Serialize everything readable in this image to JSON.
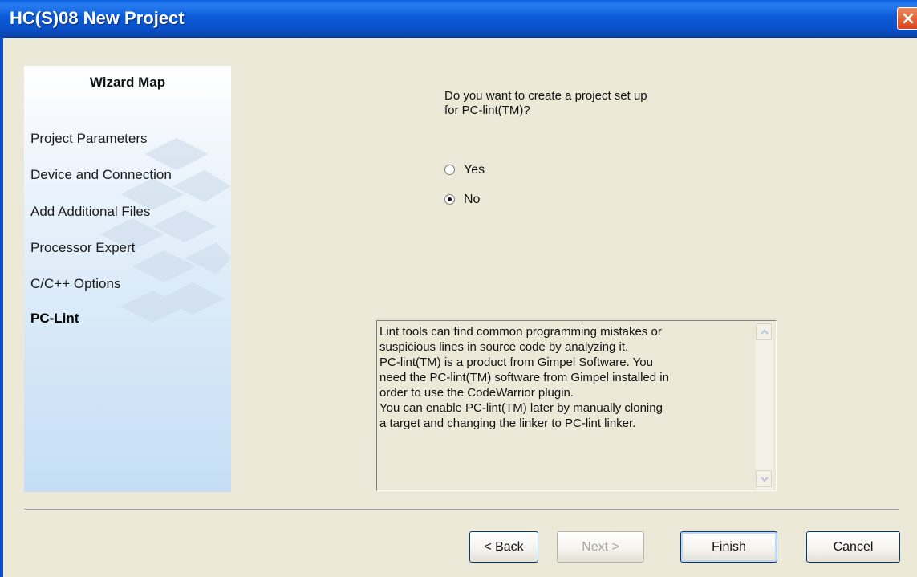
{
  "window": {
    "title": "HC(S)08 New Project"
  },
  "wizard_map": {
    "title": "Wizard Map",
    "items": [
      {
        "label": "Project Parameters"
      },
      {
        "label": "Device and Connection"
      },
      {
        "label": "Add Additional Files"
      },
      {
        "label": "Processor Expert"
      },
      {
        "label": "C/C++ Options"
      },
      {
        "label": "PC-Lint",
        "active": true
      }
    ]
  },
  "question": {
    "line1": "Do you want to create a project set up",
    "line2": "for PC-lint(TM)?"
  },
  "options": [
    {
      "label": "Yes",
      "checked": false
    },
    {
      "label": "No",
      "checked": true
    }
  ],
  "info_text": "Lint tools can find common programming mistakes or\nsuspicious lines in source code by analyzing it.\nPC-lint(TM) is a product from Gimpel Software. You\nneed the PC-lint(TM) software from Gimpel installed in\norder to use the CodeWarrior plugin.\nYou can enable PC-lint(TM) later by manually cloning\na target and changing the linker to PC-lint linker.",
  "buttons": {
    "back": "< Back",
    "next": "Next >",
    "finish": "Finish",
    "cancel": "Cancel"
  },
  "icons": {
    "close": "close-icon",
    "scroll_up": "scroll-up-arrow-icon",
    "scroll_down": "scroll-down-arrow-icon"
  },
  "colors": {
    "titlebar": "#0a4fc8",
    "close_button": "#d8431c",
    "dialog_background": "#ece9d8"
  }
}
